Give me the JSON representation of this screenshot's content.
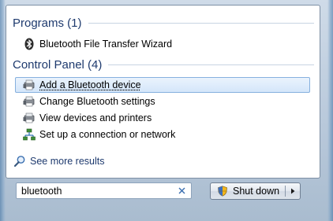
{
  "sections": [
    {
      "header": "Programs (1)",
      "items": [
        {
          "label": "Bluetooth File Transfer Wizard",
          "icon": "bluetooth-icon",
          "selected": false
        }
      ]
    },
    {
      "header": "Control Panel (4)",
      "items": [
        {
          "label": "Add a Bluetooth device",
          "icon": "printer-device-icon",
          "selected": true
        },
        {
          "label": "Change Bluetooth settings",
          "icon": "printer-device-icon",
          "selected": false
        },
        {
          "label": "View devices and printers",
          "icon": "printer-device-icon",
          "selected": false
        },
        {
          "label": "Set up a connection or network",
          "icon": "network-icon",
          "selected": false
        }
      ]
    }
  ],
  "see_more": {
    "label": "See more results",
    "icon": "search-icon"
  },
  "search": {
    "value": "bluetooth",
    "clear_icon": "clear-icon"
  },
  "shutdown": {
    "label": "Shut down",
    "icon": "shield-icon"
  },
  "colors": {
    "header_text": "#1e3a6e",
    "selection": "#d4e6fa",
    "selection_border": "#86b0de"
  }
}
